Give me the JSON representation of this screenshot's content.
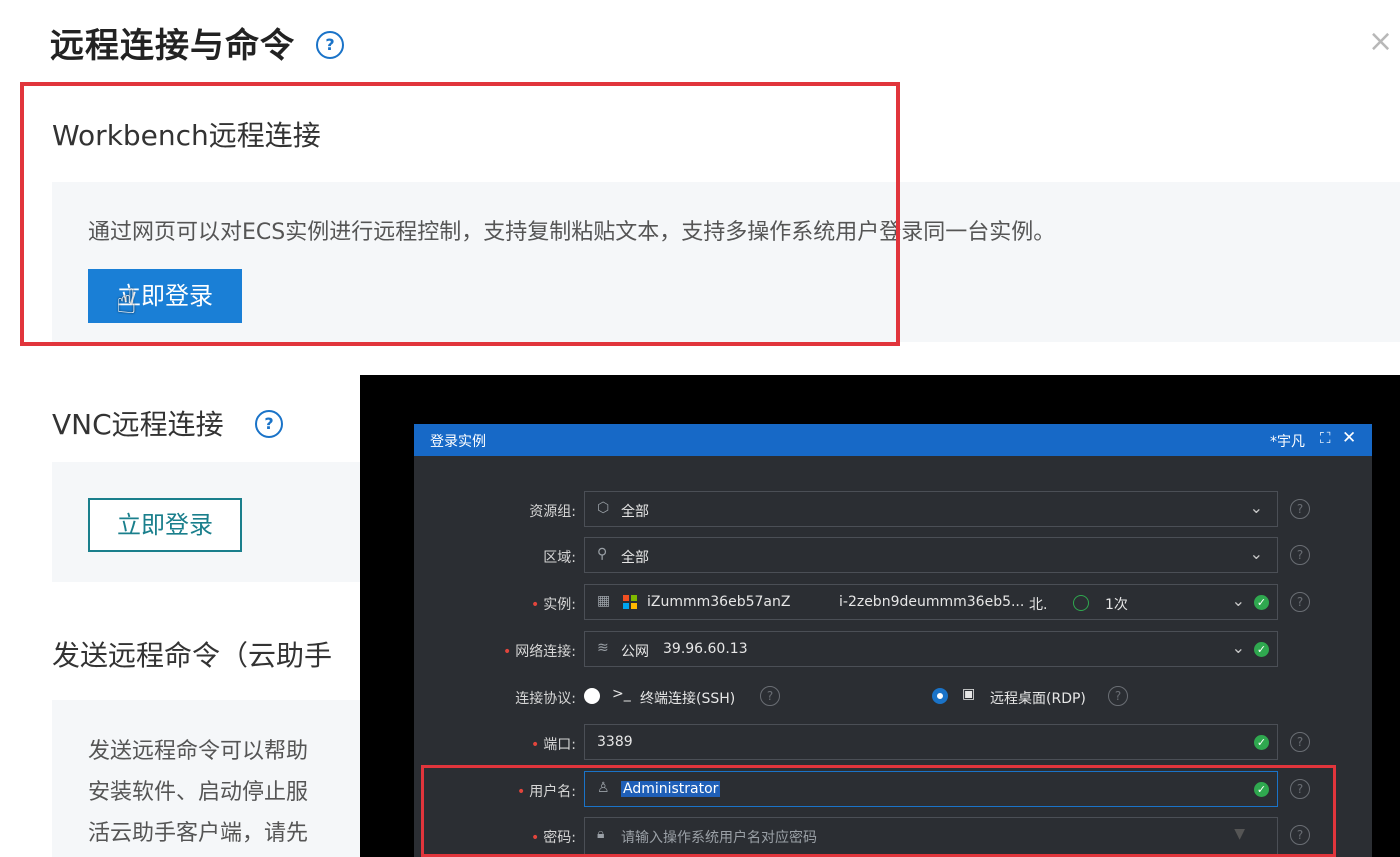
{
  "panel": {
    "title": "远程连接与命令",
    "help_glyph": "?",
    "close_glyph": "×",
    "workbench": {
      "title": "Workbench远程连接",
      "description": "通过网页可以对ECS实例进行远程控制，支持复制粘贴文本，支持多操作系统用户登录同一台实例。",
      "button": "立即登录"
    },
    "vnc": {
      "title": "VNC远程连接",
      "button": "立即登录"
    },
    "command": {
      "title": "发送远程命令（云助手",
      "lines": [
        "发送远程命令可以帮助",
        "安装软件、启动停止服",
        "活云助手客户端，请先"
      ]
    }
  },
  "dialog": {
    "title": "登录实例",
    "user": "*宇凡",
    "expand_glyph": "⛶",
    "close_glyph": "✕",
    "fields": {
      "resource_group": {
        "label": "资源组:",
        "value": "全部"
      },
      "region": {
        "label": "区域:",
        "value": "全部"
      },
      "instance": {
        "label": "实例:",
        "name": "iZummm36eb57anZ",
        "id": "i-2zebn9deummm36eb5...",
        "region": "北.",
        "count": "1次"
      },
      "network": {
        "label": "网络连接:",
        "type": "公网",
        "ip": "39.96.60.13"
      },
      "protocol": {
        "label": "连接协议:",
        "ssh": "终端连接(SSH)",
        "rdp": "远程桌面(RDP)"
      },
      "port": {
        "label": "端口:",
        "value": "3389"
      },
      "username": {
        "label": "用户名:",
        "value": "Administrator"
      },
      "password": {
        "label": "密码:",
        "placeholder": "请输入操作系统用户名对应密码"
      }
    }
  },
  "colors": {
    "primary": "#1a7fd6",
    "highlight_red": "#e1353c",
    "dialog_header": "#1769c7",
    "dialog_bg": "#2b2e33",
    "ok_green": "#2fa84f"
  }
}
